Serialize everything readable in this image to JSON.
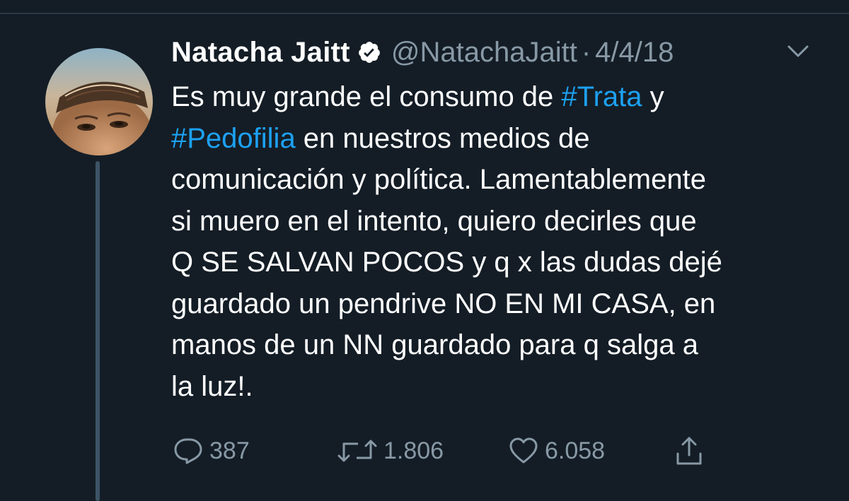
{
  "tweet": {
    "author": {
      "display_name": "Natacha Jaitt",
      "handle": "@NatachaJaitt",
      "verified": true
    },
    "separator": "·",
    "date": "4/4/18",
    "text_lines": [
      [
        {
          "t": "Es muy grande el consumo de ",
          "h": false
        },
        {
          "t": "#Trata",
          "h": true
        },
        {
          "t": " y",
          "h": false
        }
      ],
      [
        {
          "t": "#Pedofilia",
          "h": true
        },
        {
          "t": " en nuestros medios de",
          "h": false
        }
      ],
      [
        {
          "t": "comunicación y política. Lamentablemente",
          "h": false
        }
      ],
      [
        {
          "t": "si muero en el intento, quiero decirles que",
          "h": false
        }
      ],
      [
        {
          "t": "Q SE SALVAN POCOS y q x las dudas dejé",
          "h": false
        }
      ],
      [
        {
          "t": "guardado un pendrive NO EN MI CASA, en",
          "h": false
        }
      ],
      [
        {
          "t": "manos de un NN guardado para q salga a",
          "h": false
        }
      ],
      [
        {
          "t": "la luz!.",
          "h": false
        }
      ]
    ],
    "actions": {
      "reply": {
        "icon": "reply-icon",
        "count": "387"
      },
      "retweet": {
        "icon": "retweet-icon",
        "count": "1.806"
      },
      "like": {
        "icon": "heart-icon",
        "count": "6.058"
      },
      "share": {
        "icon": "share-icon"
      }
    }
  },
  "colors": {
    "background": "#141d26",
    "text": "#ffffff",
    "secondary": "#8899a6",
    "hashtag": "#1da1f2",
    "thread_line": "#3d5466"
  }
}
